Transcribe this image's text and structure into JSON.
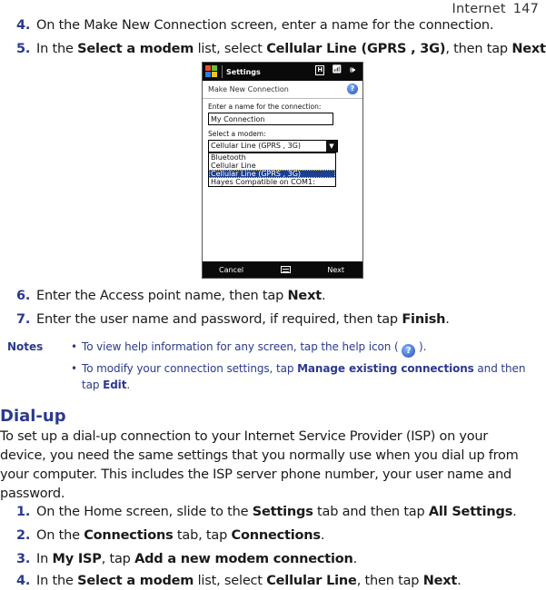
{
  "header": {
    "section": "Internet",
    "page": "147"
  },
  "steps_top": [
    {
      "num": "4.",
      "parts": [
        {
          "t": "On the Make New Connection screen, enter a name for the connection."
        }
      ]
    },
    {
      "num": "5.",
      "parts": [
        {
          "t": "In the "
        },
        {
          "t": "Select a modem",
          "b": true
        },
        {
          "t": " list, select "
        },
        {
          "t": "Cellular Line (GPRS , 3G)",
          "b": true
        },
        {
          "t": ", then tap "
        },
        {
          "t": "Next",
          "b": true
        },
        {
          "t": "."
        }
      ]
    }
  ],
  "phone": {
    "app_title": "Settings",
    "status_icons": [
      "network-h-icon",
      "signal-icon",
      "speaker-icon"
    ],
    "screen_title": "Make New Connection",
    "help_glyph": "?",
    "name_label": "Enter a name for the connection:",
    "name_value": "My Connection",
    "modem_label": "Select a modem:",
    "modem_selected": "Cellular Line (GPRS , 3G)",
    "modem_options": [
      "Bluetooth",
      "Cellular Line",
      "Cellular Line (GPRS , 3G)",
      "Hayes Compatible on COM1:"
    ],
    "modem_highlight_index": 2,
    "softkey_left": "Cancel",
    "softkey_right": "Next",
    "colors": {
      "titlebar": "#0a0a0a",
      "selection": "#1b3f91"
    }
  },
  "steps_mid": [
    {
      "num": "6.",
      "parts": [
        {
          "t": "Enter the Access point name, then tap "
        },
        {
          "t": "Next",
          "b": true
        },
        {
          "t": "."
        }
      ]
    },
    {
      "num": "7.",
      "parts": [
        {
          "t": "Enter the user name and password, if required, then tap "
        },
        {
          "t": "Finish",
          "b": true
        },
        {
          "t": "."
        }
      ]
    }
  ],
  "notes": {
    "label": "Notes",
    "bullet": "•",
    "items": [
      {
        "lines": [
          [
            {
              "t": "To view help information for any screen, tap the help icon ( "
            },
            {
              "icon": "?"
            },
            {
              "t": " )."
            }
          ]
        ]
      },
      {
        "lines": [
          [
            {
              "t": "To modify your connection settings, tap "
            },
            {
              "t": "Manage existing connections",
              "b": true
            },
            {
              "t": " and then"
            }
          ],
          [
            {
              "t": "tap "
            },
            {
              "t": "Edit",
              "b": true
            },
            {
              "t": "."
            }
          ]
        ]
      }
    ]
  },
  "dialup": {
    "title": "Dial-up",
    "paragraph_lines": [
      "To set up a dial-up connection to your Internet Service Provider (ISP) on your",
      "device, you need the same settings that you normally use when you dial up from",
      "your computer. This includes the ISP server phone number, your user name and",
      "password."
    ],
    "steps": [
      {
        "num": "1.",
        "parts": [
          {
            "t": "On the Home screen, slide to the "
          },
          {
            "t": "Settings",
            "b": true
          },
          {
            "t": " tab and then tap "
          },
          {
            "t": "All Settings",
            "b": true
          },
          {
            "t": "."
          }
        ]
      },
      {
        "num": "2.",
        "parts": [
          {
            "t": "On the "
          },
          {
            "t": "Connections",
            "b": true
          },
          {
            "t": " tab, tap "
          },
          {
            "t": "Connections",
            "b": true
          },
          {
            "t": "."
          }
        ]
      },
      {
        "num": "3.",
        "parts": [
          {
            "t": "In "
          },
          {
            "t": "My ISP",
            "b": true
          },
          {
            "t": ", tap "
          },
          {
            "t": "Add a new modem connection",
            "b": true
          },
          {
            "t": "."
          }
        ]
      },
      {
        "num": "4.",
        "parts": [
          {
            "t": "In the "
          },
          {
            "t": "Select a modem",
            "b": true
          },
          {
            "t": " list, select "
          },
          {
            "t": "Cellular Line",
            "b": true
          },
          {
            "t": ", then tap "
          },
          {
            "t": "Next",
            "b": true
          },
          {
            "t": "."
          }
        ]
      }
    ]
  },
  "colors": {
    "accent": "#2b3a8f",
    "text": "#1a1a1a"
  }
}
